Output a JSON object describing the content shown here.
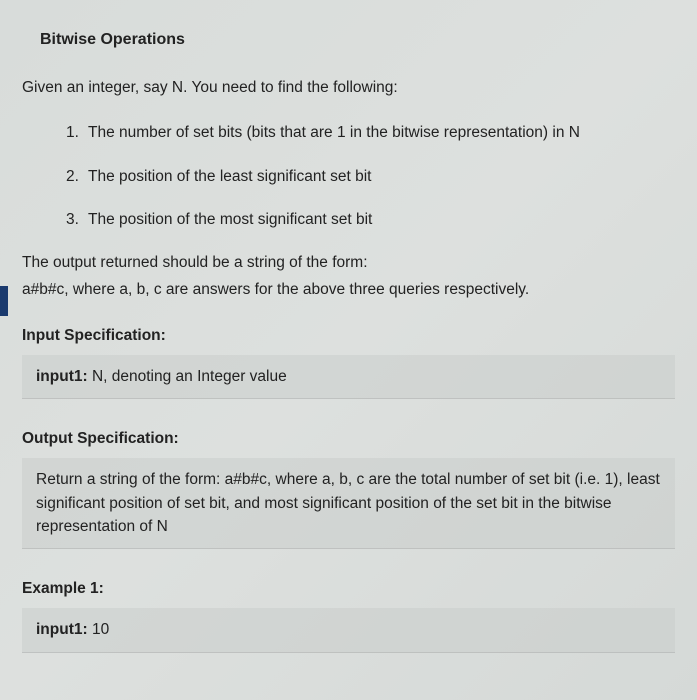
{
  "title": "Bitwise Operations",
  "intro": "Given an integer, say N. You need to find the following:",
  "list": [
    {
      "num": "1.",
      "text": "The number of set bits (bits that are 1 in the bitwise representation) in N"
    },
    {
      "num": "2.",
      "text": "The position of the least significant set bit"
    },
    {
      "num": "3.",
      "text": "The position of the most significant set bit"
    }
  ],
  "output_line1": "The output returned should be a string of the form:",
  "output_line2": "a#b#c, where a, b, c are answers for the above three queries respectively.",
  "input_spec_heading": "Input Specification:",
  "input_spec": {
    "label": "input1:",
    "text": " N, denoting an Integer value"
  },
  "output_spec_heading": "Output Specification:",
  "output_spec_text": "Return a string of the form: a#b#c, where a, b, c are the total number of set bit (i.e. 1), least significant position of set bit, and most significant position of the set bit in the bitwise representation of N",
  "example_heading": "Example 1:",
  "example": {
    "label": "input1:",
    "text": " 10"
  }
}
